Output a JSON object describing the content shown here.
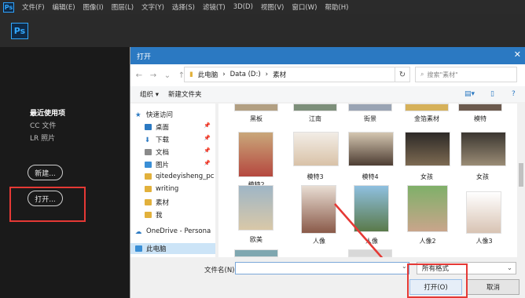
{
  "menubar": {
    "logo": "Ps",
    "items": [
      "文件(F)",
      "编辑(E)",
      "图像(I)",
      "图层(L)",
      "文字(Y)",
      "选择(S)",
      "滤镜(T)",
      "3D(D)",
      "视图(V)",
      "窗口(W)",
      "帮助(H)"
    ]
  },
  "home": {
    "logo": "Ps",
    "recent": "最近使用项",
    "cc_files": "CC 文件",
    "lr_photos": "LR 照片",
    "new_button": "新建...",
    "open_button": "打开..."
  },
  "dialog": {
    "title": "打开",
    "breadcrumb": [
      "此电脑",
      "Data (D:)",
      "素材"
    ],
    "search_placeholder": "搜索\"素材\"",
    "organize": "组织 ▾",
    "new_folder": "新建文件夹",
    "nav": [
      {
        "label": "快速访问"
      },
      {
        "label": "桌面"
      },
      {
        "label": "下载"
      },
      {
        "label": "文档"
      },
      {
        "label": "图片"
      },
      {
        "label": "qitedeyisheng_pc"
      },
      {
        "label": "writing"
      },
      {
        "label": "素材"
      },
      {
        "label": "我"
      },
      {
        "label": "OneDrive - Persona"
      },
      {
        "label": "此电脑"
      }
    ],
    "files_row1": [
      "黑板",
      "江南",
      "街景",
      "金箔素材",
      "模特"
    ],
    "files_row2": [
      "模特2",
      "模特3",
      "模特4",
      "女孩",
      "女孩"
    ],
    "files_row3": [
      "欧美",
      "人像",
      "人像",
      "人像2",
      "人像3"
    ],
    "filename_label": "文件名(N):",
    "filename_value": "",
    "filter": "所有格式",
    "open_button": "打开(O)",
    "cancel_button": "取消"
  },
  "colors": {
    "titlebar": "#2b79c2",
    "highlight_red": "#e53935",
    "ps_accent": "#31a8ff"
  }
}
